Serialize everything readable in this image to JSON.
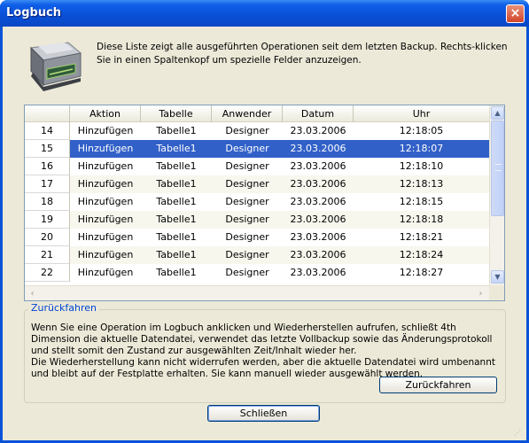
{
  "window": {
    "title": "Logbuch"
  },
  "intro_text": "Diese Liste zeigt alle ausgeführten Operationen seit dem letzten Backup. Rechts-klicken Sie in einen Spaltenkopf um spezielle Felder anzuzeigen.",
  "table": {
    "columns": [
      "Aktion",
      "Tabelle",
      "Anwender",
      "Datum",
      "Uhr"
    ],
    "rows": [
      {
        "num": "14",
        "aktion": "Hinzufügen",
        "tabelle": "Tabelle1",
        "anwender": "Designer",
        "datum": "23.03.2006",
        "uhr": "12:18:05"
      },
      {
        "num": "15",
        "aktion": "Hinzufügen",
        "tabelle": "Tabelle1",
        "anwender": "Designer",
        "datum": "23.03.2006",
        "uhr": "12:18:07"
      },
      {
        "num": "16",
        "aktion": "Hinzufügen",
        "tabelle": "Tabelle1",
        "anwender": "Designer",
        "datum": "23.03.2006",
        "uhr": "12:18:10"
      },
      {
        "num": "17",
        "aktion": "Hinzufügen",
        "tabelle": "Tabelle1",
        "anwender": "Designer",
        "datum": "23.03.2006",
        "uhr": "12:18:13"
      },
      {
        "num": "18",
        "aktion": "Hinzufügen",
        "tabelle": "Tabelle1",
        "anwender": "Designer",
        "datum": "23.03.2006",
        "uhr": "12:18:15"
      },
      {
        "num": "19",
        "aktion": "Hinzufügen",
        "tabelle": "Tabelle1",
        "anwender": "Designer",
        "datum": "23.03.2006",
        "uhr": "12:18:18"
      },
      {
        "num": "20",
        "aktion": "Hinzufügen",
        "tabelle": "Tabelle1",
        "anwender": "Designer",
        "datum": "23.03.2006",
        "uhr": "12:18:21"
      },
      {
        "num": "21",
        "aktion": "Hinzufügen",
        "tabelle": "Tabelle1",
        "anwender": "Designer",
        "datum": "23.03.2006",
        "uhr": "12:18:24"
      },
      {
        "num": "22",
        "aktion": "Hinzufügen",
        "tabelle": "Tabelle1",
        "anwender": "Designer",
        "datum": "23.03.2006",
        "uhr": "12:18:27"
      }
    ],
    "selected_row": "15"
  },
  "restore": {
    "group_title": "Zurückfahren",
    "text_line1": "Wenn Sie eine Operation im Logbuch anklicken und  Wiederherstellen aufrufen, schließt 4th Dimension die aktuelle Datendatei, verwendet das letzte Vollbackup sowie das Änderungsprotokoll und stellt somit den Zustand zur ausgewählten Zeit/Inhalt wieder her.",
    "text_line2": "Die Wiederherstellung kann nicht widerrufen werden, aber die aktuelle Datendatei wird umbenannt und bleibt auf der Festplatte erhalten. Sie kann manuell wieder ausgewählt werden.",
    "button_label": "Zurückfahren"
  },
  "close_button_label": "Schließen",
  "colors": {
    "titlebar": "#0a4fd6",
    "selection": "#3160c8",
    "dialog_bg": "#ece9d8",
    "group_title": "#0046d5"
  },
  "icons": {
    "disk": "hard-disk-icon",
    "close": "close-icon",
    "scroll_up": "scroll-up-arrow-icon",
    "scroll_down": "scroll-down-arrow-icon",
    "scroll_left": "scroll-left-arrow-icon",
    "scroll_right": "scroll-right-arrow-icon"
  }
}
